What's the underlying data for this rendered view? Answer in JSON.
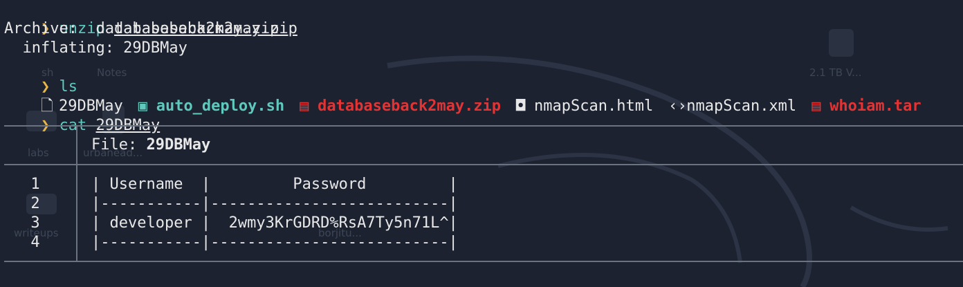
{
  "background": {
    "desktop_labels": [
      "sh",
      "Notes",
      "2.1 TB V...",
      "labs",
      "urbanead...",
      "writeups",
      "borjitu..."
    ]
  },
  "commands": [
    {
      "prompt": "❯",
      "command": "unzip",
      "arg": "databaseback2may.zip"
    },
    {
      "prompt": "❯",
      "command": "ls",
      "arg": ""
    },
    {
      "prompt": "❯",
      "command": "cat",
      "arg": "29DBMay"
    }
  ],
  "unzip_output": {
    "archive_line": "Archive:  databaseback2may.zip",
    "inflating_line": "  inflating: 29DBMay"
  },
  "ls_output": [
    {
      "icon": "file-icon",
      "glyph": "🗋",
      "name": "29DBMay",
      "kind": "plain"
    },
    {
      "icon": "terminal-icon",
      "glyph": "▣",
      "name": "auto_deploy.sh",
      "kind": "sh"
    },
    {
      "icon": "archive-icon",
      "glyph": "▤",
      "name": "databaseback2may.zip",
      "kind": "zip"
    },
    {
      "icon": "html5-icon",
      "glyph": "◘",
      "name": "nmapScan.html",
      "kind": "plain"
    },
    {
      "icon": "code-icon",
      "glyph": "‹›",
      "name": "nmapScan.xml",
      "kind": "plain"
    },
    {
      "icon": "archive-icon",
      "glyph": "▤",
      "name": "whoiam.tar",
      "kind": "zip"
    }
  ],
  "bat_view": {
    "file_label": "File: ",
    "file_name": "29DBMay",
    "line_numbers": [
      "1",
      "2",
      "3",
      "4"
    ],
    "lines": [
      "| Username  |         Password         |",
      "|-----------|--------------------------|",
      "| developer |  2wmy3KrGDRD%RsA7Ty5n71L^|",
      "|-----------|--------------------------|"
    ]
  },
  "colors": {
    "background": "#1c2230",
    "prompt": "#e7b64a",
    "command": "#5fc9be",
    "executable": "#5fc9be",
    "archive": "#e23434",
    "text": "#e8e8e8",
    "rule": "#6b7280"
  }
}
